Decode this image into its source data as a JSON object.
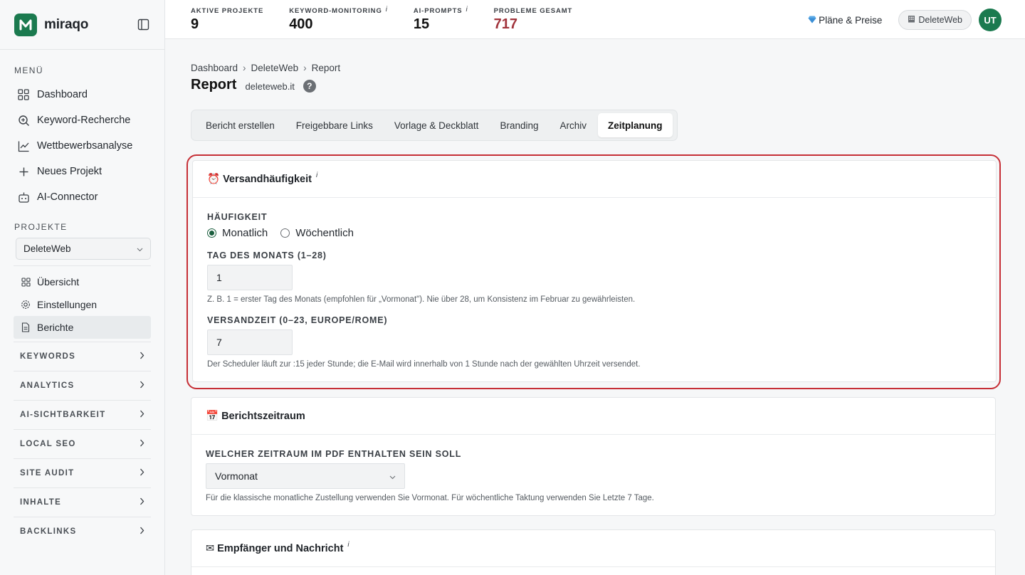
{
  "brand": {
    "name": "miraqo",
    "color": "#1b7a4f"
  },
  "sidebar": {
    "menu_label": "MENÜ",
    "menu_items": [
      {
        "label": "Dashboard",
        "icon": "grid-icon"
      },
      {
        "label": "Keyword-Recherche",
        "icon": "search-icon"
      },
      {
        "label": "Wettbewerbsanalyse",
        "icon": "chart-icon"
      },
      {
        "label": "Neues Projekt",
        "icon": "plus-icon"
      },
      {
        "label": "AI-Connector",
        "icon": "bot-icon"
      }
    ],
    "projects_label": "PROJEKTE",
    "project_select": "DeleteWeb",
    "sub_items": [
      {
        "label": "Übersicht",
        "icon": "grid-small-icon"
      },
      {
        "label": "Einstellungen",
        "icon": "gear-icon"
      },
      {
        "label": "Berichte",
        "icon": "document-icon",
        "active": true
      }
    ],
    "groups": [
      "KEYWORDS",
      "ANALYTICS",
      "AI-SICHTBARKEIT",
      "LOCAL SEO",
      "SITE AUDIT",
      "INHALTE",
      "BACKLINKS"
    ]
  },
  "topbar": {
    "stats": [
      {
        "label": "AKTIVE PROJEKTE",
        "value": "9",
        "info": ""
      },
      {
        "label": "KEYWORD-MONITORING",
        "value": "400",
        "info": "i"
      },
      {
        "label": "AI-PROMPTS",
        "value": "15",
        "info": "i"
      },
      {
        "label": "PROBLEME GESAMT",
        "value": "717",
        "info": "",
        "color": "#a1333b"
      }
    ],
    "plans_label": "Pläne & Preise",
    "workspace": "DeleteWeb",
    "avatar": "UT"
  },
  "breadcrumb": [
    "Dashboard",
    "DeleteWeb",
    "Report"
  ],
  "breadcrumb_sep": "›",
  "page": {
    "title": "Report",
    "domain": "deleteweb.it",
    "help": "?"
  },
  "tabs": [
    "Bericht erstellen",
    "Freigebbare Links",
    "Vorlage & Deckblatt",
    "Branding",
    "Archiv",
    "Zeitplanung"
  ],
  "active_tab": "Zeitplanung",
  "frequency_card": {
    "emoji": "⏰",
    "title": "Versandhäufigkeit",
    "info": "i",
    "frequency_label": "HÄUFIGKEIT",
    "options": [
      "Monatlich",
      "Wöchentlich"
    ],
    "selected": "Monatlich",
    "day_label": "TAG DES MONATS (1–28)",
    "day_value": "1",
    "day_help": "Z. B. 1 = erster Tag des Monats (empfohlen für „Vormonat\"). Nie über 28, um Konsistenz im Februar zu gewährleisten.",
    "time_label": "VERSANDZEIT (0–23, EUROPE/ROME)",
    "time_value": "7",
    "time_help": "Der Scheduler läuft zur :15 jeder Stunde; die E-Mail wird innerhalb von 1 Stunde nach der gewählten Uhrzeit versendet."
  },
  "period_card": {
    "emoji": "📅",
    "title": "Berichtszeitraum",
    "period_label": "WELCHER ZEITRAUM IM PDF ENTHALTEN SEIN SOLL",
    "period_value": "Vormonat",
    "period_help": "Für die klassische monatliche Zustellung verwenden Sie Vormonat. Für wöchentliche Taktung verwenden Sie Letzte 7 Tage."
  },
  "recipients_card": {
    "emoji": "✉",
    "title": "Empfänger und Nachricht",
    "info": "i"
  },
  "colors": {
    "accent": "#1b7a4f",
    "highlight": "#c62f36",
    "danger": "#a1333b"
  }
}
